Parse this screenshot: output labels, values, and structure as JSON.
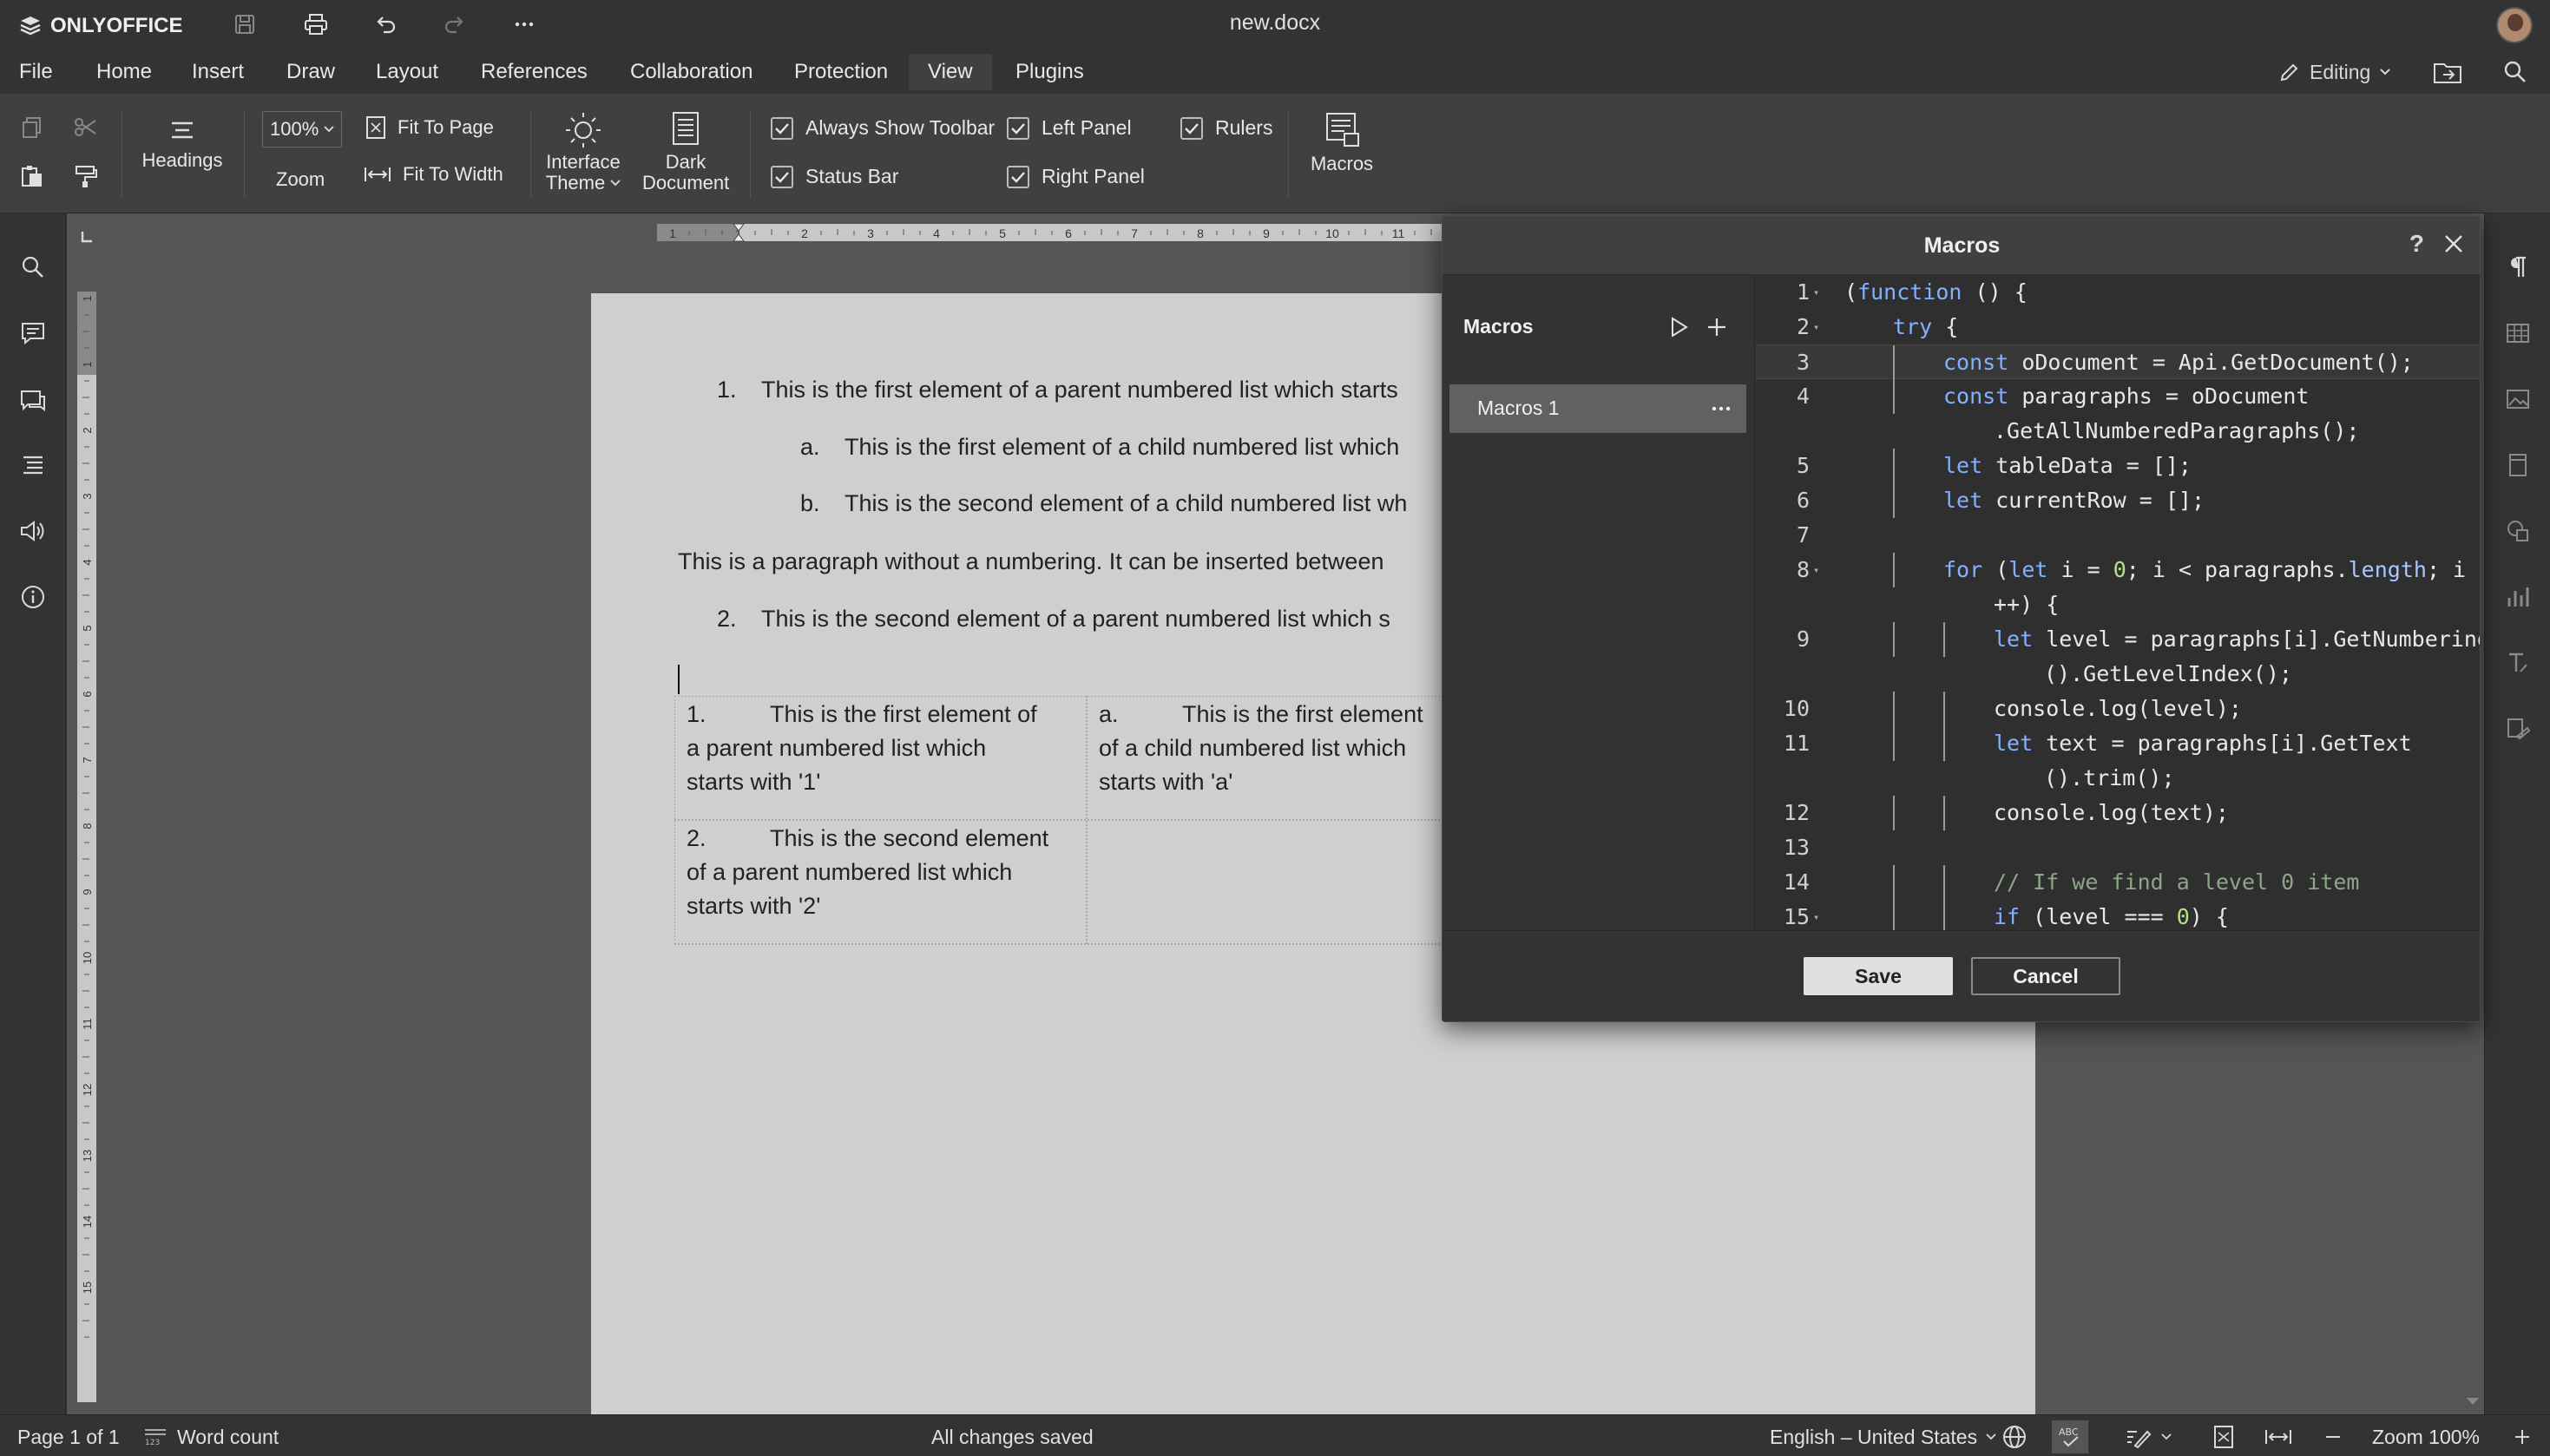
{
  "app": {
    "logo_text": "ONLYOFFICE",
    "doc_title": "new.docx"
  },
  "menu": {
    "tabs": [
      "File",
      "Home",
      "Insert",
      "Draw",
      "Layout",
      "References",
      "Collaboration",
      "Protection",
      "View",
      "Plugins"
    ],
    "active_tab": "View",
    "mode_label": "Editing"
  },
  "toolbar": {
    "headings_label": "Headings",
    "zoom_value": "100%",
    "zoom_label": "Zoom",
    "fit_page_label": "Fit To Page",
    "fit_width_label": "Fit To Width",
    "interface_theme_label_1": "Interface",
    "interface_theme_label_2": "Theme",
    "dark_document_label_1": "Dark",
    "dark_document_label_2": "Document",
    "always_show_toolbar_label": "Always Show Toolbar",
    "status_bar_label": "Status Bar",
    "left_panel_label": "Left Panel",
    "right_panel_label": "Right Panel",
    "rulers_label": "Rulers",
    "macros_label": "Macros",
    "always_show_toolbar_checked": true,
    "status_bar_checked": true,
    "left_panel_checked": true,
    "right_panel_checked": true,
    "rulers_checked": true
  },
  "ruler": {
    "h_ticks": [
      "1",
      "1",
      "2",
      "3",
      "4",
      "5",
      "6",
      "7",
      "8",
      "9",
      "10",
      "11"
    ],
    "v_ticks": [
      "1",
      "1",
      "2",
      "3",
      "4",
      "5",
      "6",
      "7",
      "8",
      "9",
      "10",
      "11",
      "12",
      "13",
      "14",
      "15"
    ]
  },
  "document": {
    "list": [
      {
        "num": "1.",
        "text": "This is the first element of a parent numbered list which starts"
      },
      {
        "num": "a.",
        "text": "This is the first element of a child numbered list which"
      },
      {
        "num": "b.",
        "text": "This is the second element of a child numbered list wh"
      }
    ],
    "paragraph": "This is a paragraph without a numbering. It can be inserted between",
    "list2": {
      "num": "2.",
      "text": "This is the second element of a parent numbered list which s"
    },
    "table": {
      "r1c1": {
        "num": "1.",
        "line1": "This is the first element of",
        "line2": "a parent numbered list which",
        "line3": "starts with '1'"
      },
      "r1c2": {
        "num": "a.",
        "line1": "This is the first element",
        "line2": "of a child numbered list which",
        "line3": "starts with 'a'"
      },
      "r2c1": {
        "num": "2.",
        "line1": "This is the second element",
        "line2": "of a parent numbered list which",
        "line3": "starts with '2'"
      }
    }
  },
  "macros_dialog": {
    "title": "Macros",
    "help": "?",
    "list_title": "Macros",
    "items": [
      "Macros 1"
    ],
    "save_label": "Save",
    "cancel_label": "Cancel",
    "code_line_numbers": [
      "1",
      "2",
      "3",
      "4",
      "",
      "5",
      "6",
      "7",
      "8",
      "",
      "9",
      "",
      "10",
      "11",
      "",
      "12",
      "13",
      "14",
      "15"
    ]
  },
  "statusbar": {
    "page": "Page 1 of 1",
    "word_count": "Word count",
    "save_state": "All changes saved",
    "language": "English – United States",
    "zoom": "Zoom 100%"
  }
}
